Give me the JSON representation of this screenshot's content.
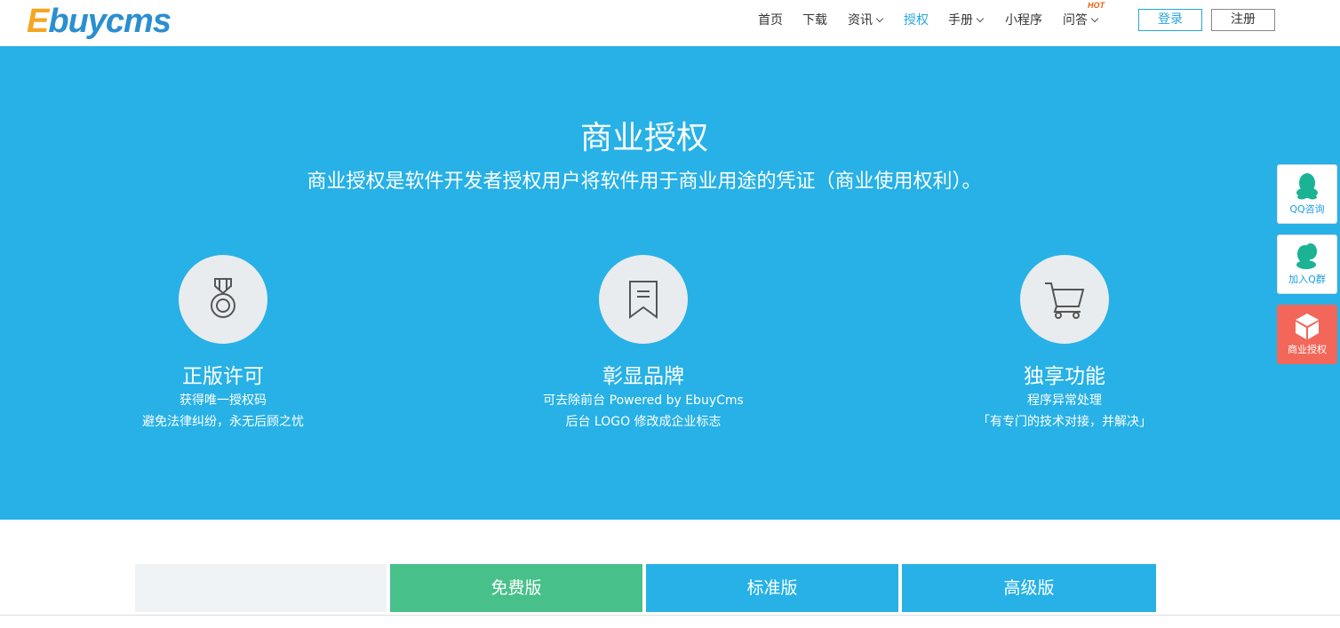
{
  "header": {
    "logo_first": "E",
    "logo_rest": "buycms",
    "nav": [
      {
        "label": "首页"
      },
      {
        "label": "下载"
      },
      {
        "label": "资讯"
      },
      {
        "label": "授权"
      },
      {
        "label": "手册"
      },
      {
        "label": "小程序"
      },
      {
        "label": "问答"
      }
    ],
    "hot_badge": "HOT",
    "login": "登录",
    "register": "注册"
  },
  "hero": {
    "title": "商业授权",
    "subtitle": "商业授权是软件开发者授权用户将软件用于商业用途的凭证（商业使用权利）。",
    "features": [
      {
        "icon": "medal-icon",
        "title": "正版许可",
        "line1": "获得唯一授权码",
        "line2": "避免法律纠纷，永无后顾之忧"
      },
      {
        "icon": "bookmark-icon",
        "title": "彰显品牌",
        "line1": "可去除前台 Powered by EbuyCms",
        "line2": "后台 LOGO 修改成企业标志"
      },
      {
        "icon": "cart-icon",
        "title": "独享功能",
        "line1": "程序异常处理",
        "line2": "「有专门的技术对接，并解决」"
      }
    ]
  },
  "side": {
    "qq": "QQ咨询",
    "group": "加入Q群",
    "license": "商业授权"
  },
  "pricing": {
    "free": "免费版",
    "standard": "标准版",
    "premium": "高级版"
  },
  "colors": {
    "hero_bg": "#27b1e6",
    "free_bg": "#48c08a",
    "paid_bg": "#27b1e6",
    "side_red": "#f2675a"
  }
}
